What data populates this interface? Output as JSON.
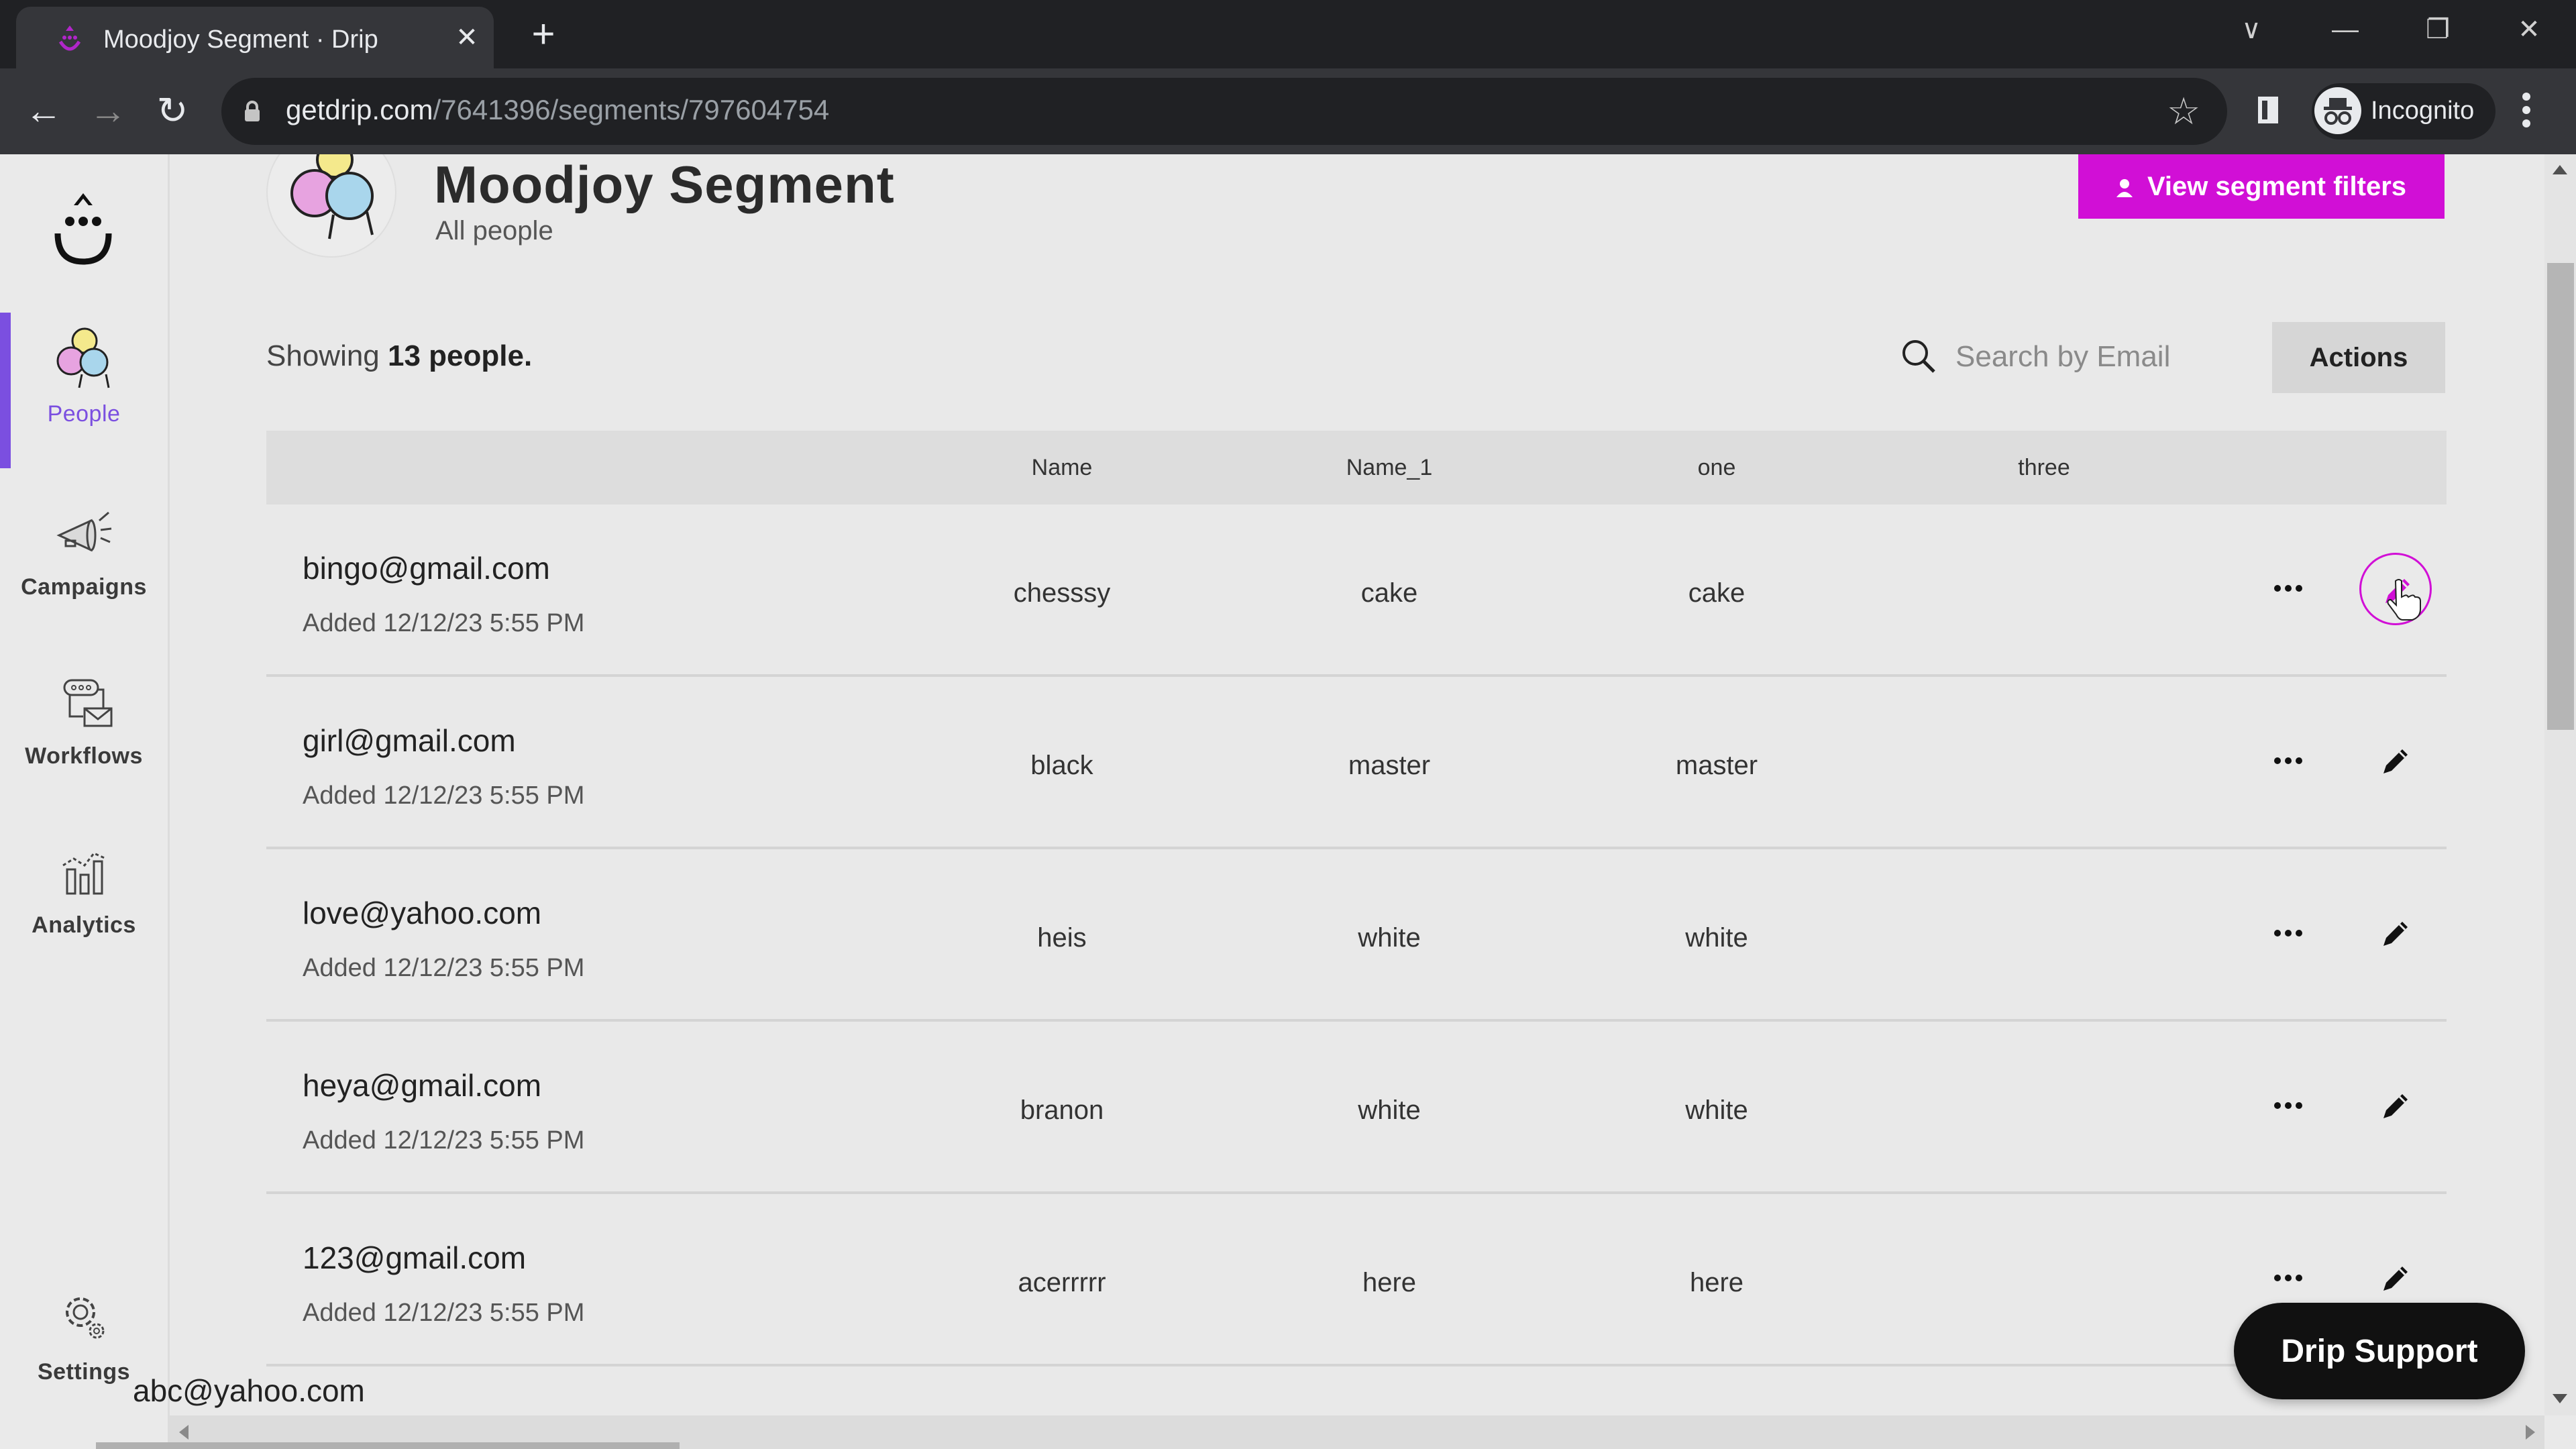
{
  "browser": {
    "tab_title": "Moodjoy Segment · Drip",
    "new_tab_label": "+",
    "url_host": "getdrip.com",
    "url_path": "/7641396/segments/797604754",
    "incognito_label": "Incognito",
    "window_controls": {
      "tab_search": "∨",
      "minimize": "—",
      "restore": "❐",
      "close": "✕"
    }
  },
  "sidebar": {
    "items": [
      {
        "label": "People",
        "icon": "people-icon",
        "active": true
      },
      {
        "label": "Campaigns",
        "icon": "megaphone-icon",
        "active": false
      },
      {
        "label": "Workflows",
        "icon": "workflow-icon",
        "active": false
      },
      {
        "label": "Analytics",
        "icon": "analytics-icon",
        "active": false
      },
      {
        "label": "Settings",
        "icon": "gear-icon",
        "active": false
      }
    ]
  },
  "header": {
    "title": "Moodjoy Segment",
    "subtitle": "All people",
    "view_filters_label": "View segment filters"
  },
  "summary": {
    "prefix": "Showing ",
    "count": "13 people.",
    "search_placeholder": "Search by Email",
    "search_value": "",
    "actions_label": "Actions"
  },
  "table": {
    "columns": [
      "Name",
      "Name_1",
      "one",
      "three"
    ],
    "rows": [
      {
        "email": "bingo@gmail.com",
        "added": "Added 12/12/23 5:55 PM",
        "name": "chesssy",
        "name_1": "cake",
        "one": "cake",
        "three": ""
      },
      {
        "email": "girl@gmail.com",
        "added": "Added 12/12/23 5:55 PM",
        "name": "black",
        "name_1": "master",
        "one": "master",
        "three": ""
      },
      {
        "email": "love@yahoo.com",
        "added": "Added 12/12/23 5:55 PM",
        "name": "heis",
        "name_1": "white",
        "one": "white",
        "three": ""
      },
      {
        "email": "heya@gmail.com",
        "added": "Added 12/12/23 5:55 PM",
        "name": "branon",
        "name_1": "white",
        "one": "white",
        "three": ""
      },
      {
        "email": "123@gmail.com",
        "added": "Added 12/12/23 5:55 PM",
        "name": "acerrrrr",
        "name_1": "here",
        "one": "here",
        "three": ""
      }
    ],
    "partial_row_email": "abc@yahoo.com"
  },
  "support": {
    "label": "Drip Support"
  },
  "colors": {
    "accent_magenta": "#d10fd6",
    "active_nav_purple": "#7b4fe0",
    "page_bg": "#e9e9e9"
  }
}
